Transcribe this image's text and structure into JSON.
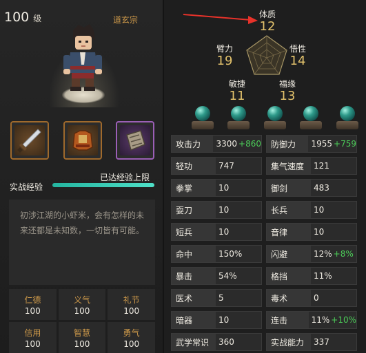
{
  "character": {
    "level": "100",
    "level_unit": "级",
    "sect": "道玄宗",
    "bio": "初涉江湖的小虾米，会有怎样的未来还都是未知数，一切皆有可能。"
  },
  "equipment": [
    {
      "slot": "weapon",
      "icon": "sword-icon",
      "rarity_color": "#a06a2c"
    },
    {
      "slot": "armor",
      "icon": "armor-icon",
      "rarity_color": "#a06a2c"
    },
    {
      "slot": "item",
      "icon": "scroll-icon",
      "rarity_color": "#9b5fb6"
    }
  ],
  "experience": {
    "label": "实战经验",
    "status": "已达经验上限",
    "progress_percent": 100
  },
  "virtues": [
    {
      "name": "仁德",
      "value": "100"
    },
    {
      "name": "义气",
      "value": "100"
    },
    {
      "name": "礼节",
      "value": "100"
    },
    {
      "name": "信用",
      "value": "100"
    },
    {
      "name": "智慧",
      "value": "100"
    },
    {
      "name": "勇气",
      "value": "100"
    }
  ],
  "attributes": {
    "constitution": {
      "name": "体质",
      "value": "12"
    },
    "strength": {
      "name": "臂力",
      "value": "19"
    },
    "perception": {
      "name": "悟性",
      "value": "14"
    },
    "agility": {
      "name": "敏捷",
      "value": "11"
    },
    "fortune": {
      "name": "福缘",
      "value": "13"
    }
  },
  "orbs": [
    "orb-icon",
    "orb-icon",
    "orb-icon",
    "orb-icon",
    "orb-icon"
  ],
  "stats": [
    {
      "name": "攻击力",
      "value": "3300",
      "bonus": "+860"
    },
    {
      "name": "防御力",
      "value": "1955",
      "bonus": "+759"
    },
    {
      "name": "轻功",
      "value": "747",
      "bonus": ""
    },
    {
      "name": "集气速度",
      "value": "121",
      "bonus": ""
    },
    {
      "name": "拳掌",
      "value": "10",
      "bonus": ""
    },
    {
      "name": "御剑",
      "value": "483",
      "bonus": ""
    },
    {
      "name": "耍刀",
      "value": "10",
      "bonus": ""
    },
    {
      "name": "长兵",
      "value": "10",
      "bonus": ""
    },
    {
      "name": "短兵",
      "value": "10",
      "bonus": ""
    },
    {
      "name": "音律",
      "value": "10",
      "bonus": ""
    },
    {
      "name": "命中",
      "value": "150%",
      "bonus": ""
    },
    {
      "name": "闪避",
      "value": "12%",
      "bonus": "+8%"
    },
    {
      "name": "暴击",
      "value": "54%",
      "bonus": ""
    },
    {
      "name": "格挡",
      "value": "11%",
      "bonus": ""
    },
    {
      "name": "医术",
      "value": "5",
      "bonus": ""
    },
    {
      "name": "毒术",
      "value": "0",
      "bonus": ""
    },
    {
      "name": "暗器",
      "value": "10",
      "bonus": ""
    },
    {
      "name": "连击",
      "value": "11%",
      "bonus": "+10%"
    },
    {
      "name": "武学常识",
      "value": "360",
      "bonus": ""
    },
    {
      "name": "实战能力",
      "value": "337",
      "bonus": ""
    }
  ],
  "colors": {
    "accent_gold": "#e3c26c",
    "sect_orange": "#cf9a4a",
    "bonus_green": "#4ccc58",
    "exp_teal": "#4fe0c8",
    "arrow_red": "#e8322a"
  }
}
